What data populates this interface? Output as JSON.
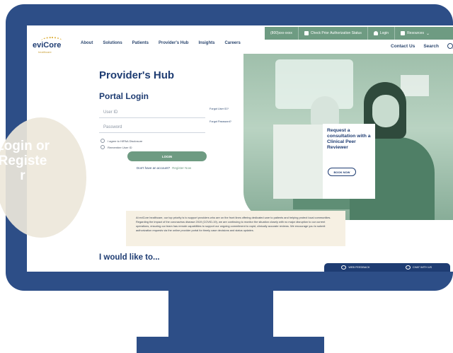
{
  "utility_bar": {
    "phone": "(800)xxx-xxxx",
    "check_status": "Check Prior Authorization Status",
    "login": "Login",
    "resources": "Resources"
  },
  "logo": {
    "word": "eviCore",
    "sub": "healthcare"
  },
  "nav": {
    "items": [
      "About",
      "Solutions",
      "Patients",
      "Provider's Hub",
      "Insights",
      "Careers"
    ],
    "contact": "Contact Us",
    "search": "Search"
  },
  "hub": {
    "title": "Provider's Hub",
    "portal_title": "Portal Login",
    "user_id_placeholder": "User ID",
    "password_placeholder": "Password",
    "forgot_user": "Forgot User ID?",
    "forgot_password": "Forgot Password?",
    "hipaa": "I agree to HIPAA Disclosure",
    "remember": "Remember User ID",
    "login_button": "LOGIN",
    "no_account": "Don't have an account?",
    "register_now": "Register Now"
  },
  "consult": {
    "text": "Request a consultation with a Clinical Peer Reviewer",
    "button": "BOOK NOW"
  },
  "notice": "At eviCore healthcare, our top priority is to support providers who are on the front lines offering dedicated care to patients and helping protect local communities. Regarding the impact of the coronavirus disease 2019 (COVID-19), we are continuing to monitor the situation closely with no major disruption to our current operations, ensuring our team has remote capabilities to support our ongoing commitment to rapid, clinically accurate reviews. We encourage you to submit authorization requests via the online provider portal for timely case decisions and status updates.",
  "like_title": "I would like to...",
  "bottom_bar": {
    "feedback": "WEB FEEDBACK",
    "chat": "CHAT WITH US"
  },
  "circle_label": "Login or Register",
  "colors": {
    "navy": "#2d4e87",
    "green": "#6e9b82",
    "cream": "#ede7da"
  }
}
